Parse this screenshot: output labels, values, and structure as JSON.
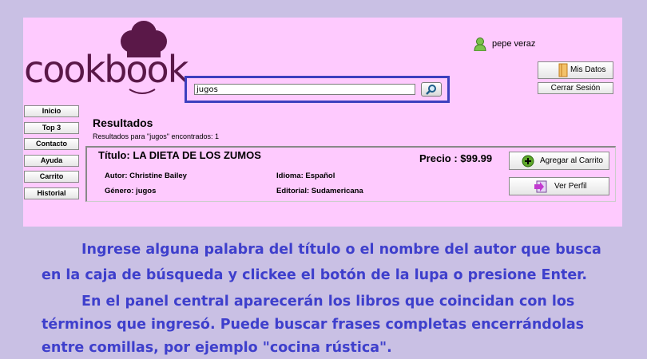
{
  "app": {
    "logo_text": "cookbook"
  },
  "search": {
    "value": "jugos",
    "button_icon": "magnifier-icon"
  },
  "user": {
    "name": "pepe veraz",
    "icon": "user-icon"
  },
  "account": {
    "mis_datos": "Mis Datos",
    "cerrar_sesion": "Cerrar Sesión"
  },
  "sidebar": {
    "items": [
      {
        "label": "Inicio"
      },
      {
        "label": "Top 3"
      },
      {
        "label": "Contacto"
      },
      {
        "label": "Ayuda"
      },
      {
        "label": "Carrito"
      },
      {
        "label": "Historial"
      }
    ]
  },
  "results": {
    "title": "Resultados",
    "subtitle": "Resultados para \"jugos\" encontrados: 1",
    "book": {
      "title": "Título: LA DIETA DE LOS ZUMOS",
      "price": "Precio : $99.99",
      "author": "Autor: Christine Bailey",
      "language": "Idioma: Español",
      "genre": "Género: jugos",
      "publisher": "Editorial: Sudamericana",
      "add_to_cart": "Agregar al Carrito",
      "view_profile": "Ver Perfil"
    }
  },
  "instructions": {
    "line1": "Ingrese alguna palabra del título o el nombre del  autor que busca",
    "line2": "en la caja de búsqueda y clickee el botón de la lupa o presione Enter.",
    "line3": "En el panel central aparecerán los libros que coincidan con los",
    "line4": "términos que ingresó. Puede buscar frases completas encerrándolas",
    "line5": "entre comillas, por ejemplo \"cocina rústica\"."
  },
  "colors": {
    "background": "#c9c0e4",
    "panel": "#fecafe",
    "accent": "#3d3fbf",
    "logo": "#5a1848"
  }
}
